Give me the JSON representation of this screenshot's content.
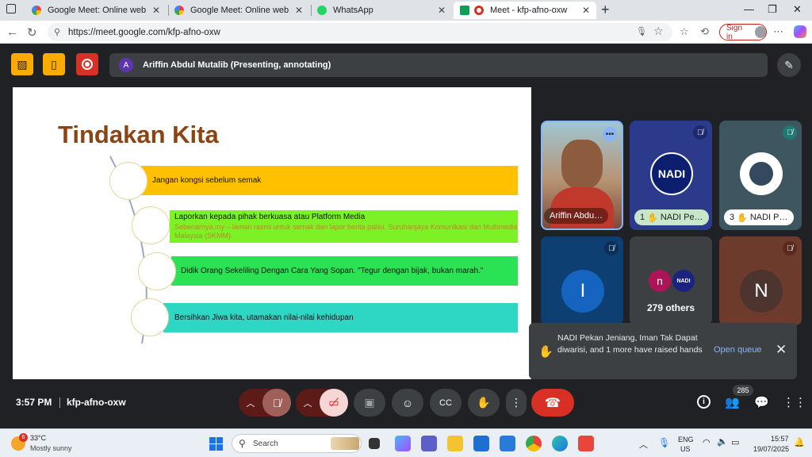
{
  "browser": {
    "tabs": [
      {
        "title": "Google Meet: Online web and vid",
        "active": false
      },
      {
        "title": "Google Meet: Online web and vid",
        "active": false
      },
      {
        "title": "WhatsApp",
        "active": false
      },
      {
        "title": "Meet - kfp-afno-oxw",
        "active": true
      }
    ],
    "url": "https://meet.google.com/kfp-afno-oxw",
    "sign_in": "Sign in"
  },
  "meet": {
    "presenter_text": "Ariffin Abdul Mutalib (Presenting, annotating)",
    "presenter_initial": "A",
    "slide": {
      "title": "Tindakan Kita",
      "items": [
        {
          "text": "Jangan kongsi sebelum semak",
          "sub": ""
        },
        {
          "text": "Laporkan kepada pihak berkuasa atau Platform Media",
          "sub": "Sebenarnya.my – laman rasmi untuk semak dan lapor berita palsu. Suruhanjaya Komunikasi dan Multimedia Malaysia (SKMM)."
        },
        {
          "text": "Didik Orang Sekeliling Dengan Cara Yang Sopan. \"Tegur dengan bijak, bukan marah.\"",
          "sub": ""
        },
        {
          "text": "Bersihkan Jiwa kita, utamakan nilai-nilai kehidupan",
          "sub": ""
        }
      ]
    },
    "tiles": [
      {
        "name": "Ariffin Abdu…"
      },
      {
        "name": "NADI Pe…",
        "hand_count": "1",
        "logo_text": "NADI"
      },
      {
        "name": "NADI P…",
        "hand_count": "3"
      },
      {
        "initial": "I"
      },
      {
        "others_text": "279 others",
        "initial": "n",
        "logo_text": "NADI"
      },
      {
        "initial": "N"
      }
    ],
    "notification": {
      "message": "NADI Pekan Jeniang, Iman Tak Dapat diwarisi, and 1 more have raised hands",
      "action": "Open queue"
    },
    "time": "3:57 PM",
    "meeting_code": "kfp-afno-oxw",
    "participant_count": "285"
  },
  "taskbar": {
    "weather_badge": "6",
    "temperature": "33°C",
    "condition": "Mostly sunny",
    "search_placeholder": "Search",
    "lang_line1": "ENG",
    "lang_line2": "US",
    "clock_time": "15:57",
    "clock_date": "19/07/2025"
  }
}
